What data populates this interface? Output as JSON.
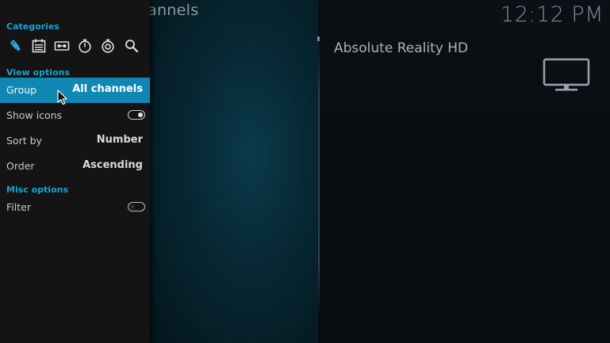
{
  "header": {
    "title": "annels",
    "clock": "12:12 PM"
  },
  "preview": {
    "channel_name": "Absolute Reality HD",
    "tv_icon": "tv-icon"
  },
  "sidebar": {
    "categories_label": "Categories",
    "category_icons": [
      "usb-stick-icon",
      "calendar-icon",
      "recording-icon",
      "timer-icon",
      "timer-rules-icon",
      "search-icon"
    ],
    "view_options_label": "View options",
    "group": {
      "label": "Group",
      "value": "All channels"
    },
    "show_icons": {
      "label": "Show icons",
      "enabled": true
    },
    "sort_by": {
      "label": "Sort by",
      "value": "Number"
    },
    "order": {
      "label": "Order",
      "value": "Ascending"
    },
    "misc_options_label": "Misc options",
    "filter": {
      "label": "Filter",
      "enabled": false
    }
  },
  "colors": {
    "accent": "#17a3d2",
    "selected_row": "#1187b4",
    "sidebar_bg": "#141414"
  }
}
